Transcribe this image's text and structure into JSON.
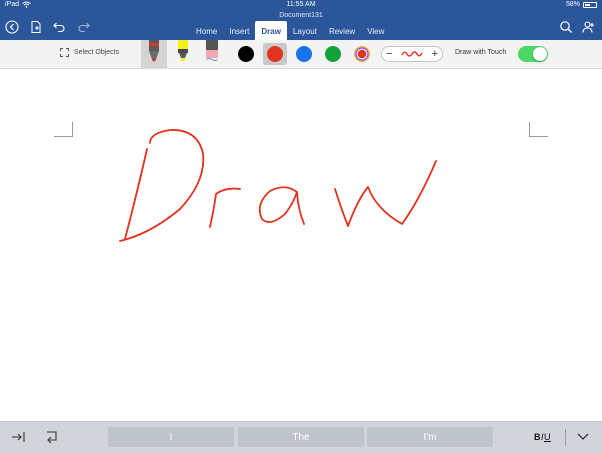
{
  "status_bar": {
    "device": "iPad",
    "time": "11:55 AM",
    "battery": "58%"
  },
  "document": {
    "title": "Document131"
  },
  "ribbon": {
    "tabs": [
      {
        "label": "Home",
        "active": false
      },
      {
        "label": "Insert",
        "active": false
      },
      {
        "label": "Draw",
        "active": true
      },
      {
        "label": "Layout",
        "active": false
      },
      {
        "label": "Review",
        "active": false
      },
      {
        "label": "View",
        "active": false
      }
    ]
  },
  "toolbar": {
    "select_objects_label": "Select Objects",
    "pens": [
      {
        "name": "pen",
        "color": "#d23a2a",
        "selected": true
      },
      {
        "name": "highlighter",
        "color": "#f6f01a",
        "selected": false
      },
      {
        "name": "eraser",
        "color": "#f3a6b4",
        "selected": false
      }
    ],
    "colors": [
      {
        "name": "black",
        "hex": "#000000",
        "selected": false
      },
      {
        "name": "red",
        "hex": "#e3321f",
        "selected": true
      },
      {
        "name": "blue",
        "hex": "#1a73e8",
        "selected": false
      },
      {
        "name": "green",
        "hex": "#12a33c",
        "selected": false
      },
      {
        "name": "more-colors",
        "hex": "#e3321f",
        "selected": false
      }
    ],
    "thickness_minus": "−",
    "thickness_plus": "+",
    "draw_with_touch_label": "Draw with Touch",
    "draw_with_touch_on": true
  },
  "canvas": {
    "ink_text": "Draw",
    "ink_color": "#e3321f"
  },
  "keyboard_bar": {
    "suggestions": [
      "I",
      "The",
      "I'm"
    ],
    "format_b": "B",
    "format_i": "I",
    "format_u": "U"
  },
  "colors": {
    "ribbon_blue": "#2b579a",
    "toggle_green": "#4cd964"
  }
}
